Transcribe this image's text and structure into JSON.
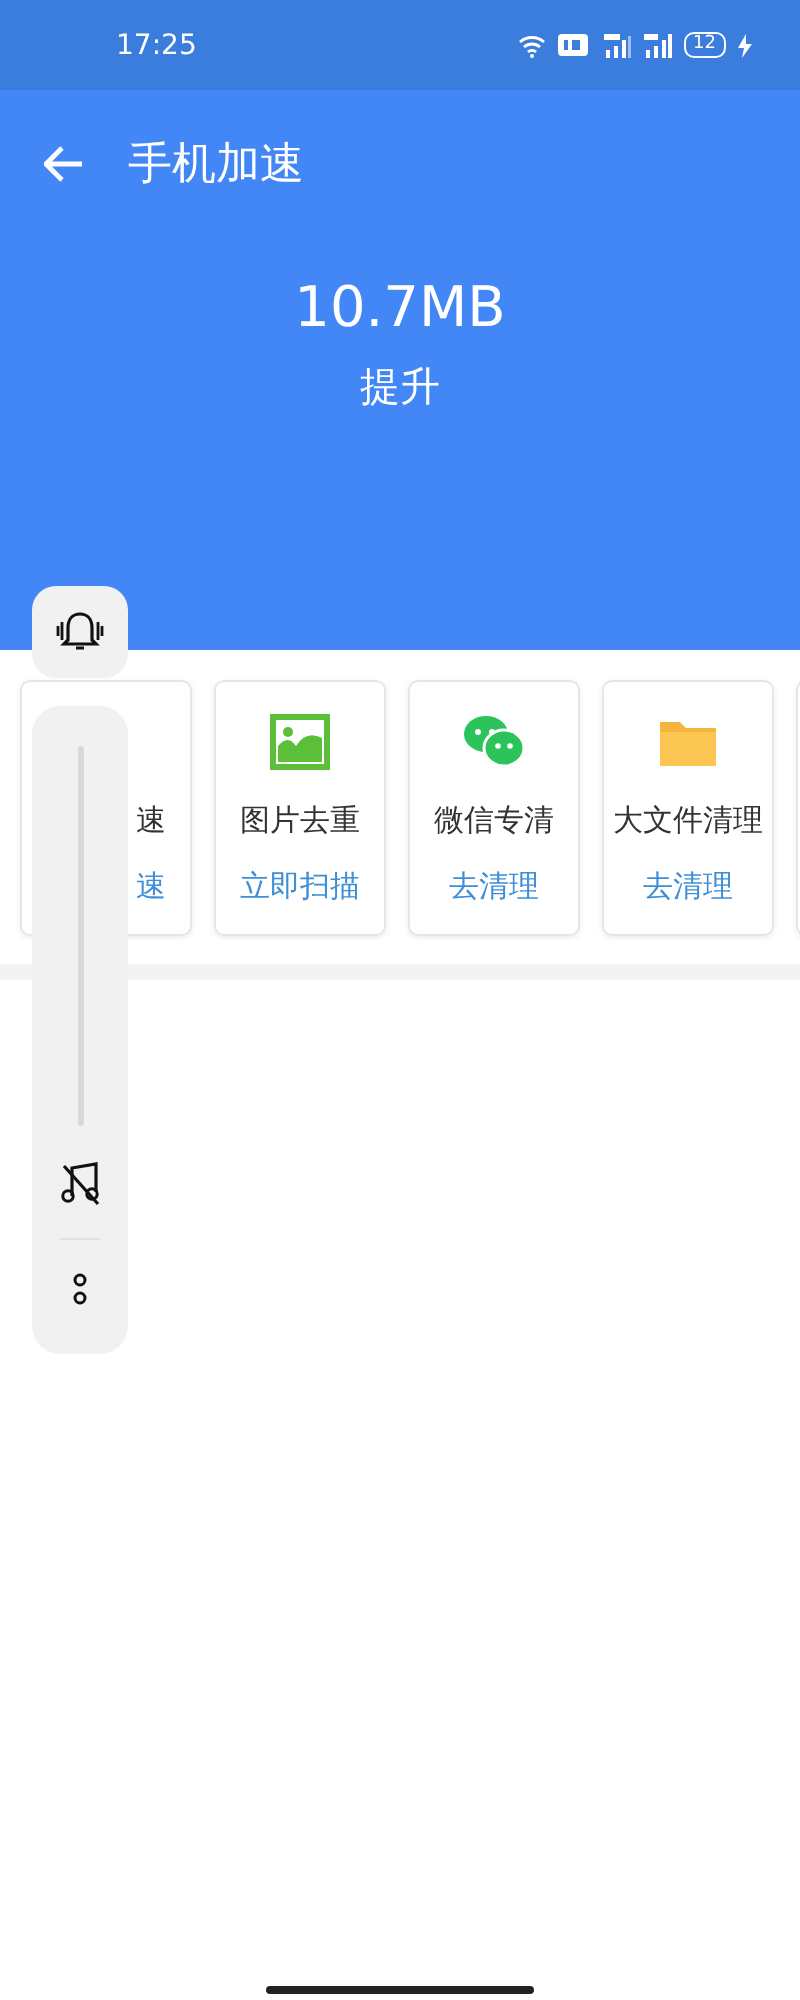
{
  "status_bar": {
    "time": "17:25",
    "battery": "12"
  },
  "header": {
    "title": "手机加速",
    "amount": "10.7MB",
    "caption": "提升"
  },
  "tools": [
    {
      "kind": "boost",
      "label": "速",
      "action": "速"
    },
    {
      "kind": "image",
      "label": "图片去重",
      "action": "立即扫描"
    },
    {
      "kind": "chat",
      "label": "微信专清",
      "action": "去清理"
    },
    {
      "kind": "folder",
      "label": "大文件清理",
      "action": "去清理"
    },
    {
      "kind": "more"
    }
  ],
  "volume": {
    "level": 0
  }
}
